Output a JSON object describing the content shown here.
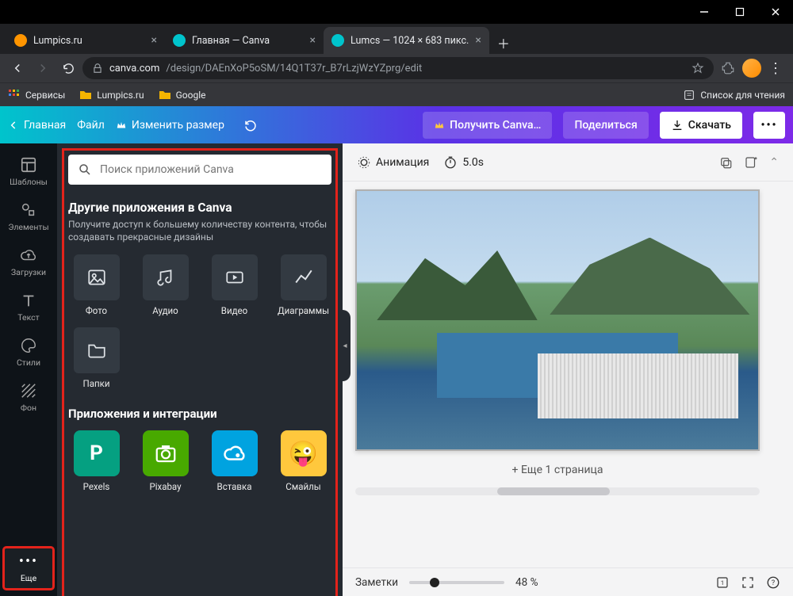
{
  "window_controls": {
    "minimize": "—",
    "maximize": "▢",
    "close": "✕"
  },
  "browser": {
    "tabs": [
      {
        "title": "Lumpics.ru",
        "favicon": "#ff9500",
        "active": false
      },
      {
        "title": "Главная — Canva",
        "favicon": "#00c4cc",
        "active": false
      },
      {
        "title": "Lumcs — 1024 × 683 пикс.",
        "favicon": "#00c4cc",
        "active": true
      }
    ],
    "url_host": "canva.com",
    "url_path": "/design/DAEnXoP5oSM/14Q1T37r_B7rLzjWzYZprg/edit",
    "bookmarks": [
      {
        "label": "Сервисы"
      },
      {
        "label": "Lumpics.ru"
      },
      {
        "label": "Google"
      }
    ],
    "reading_list": "Список для чтения"
  },
  "canva_top": {
    "home": "Главная",
    "file": "Файл",
    "resize": "Изменить размер",
    "get_pro": "Получить Canva…",
    "share": "Поделиться",
    "download": "Скачать"
  },
  "side_rail": [
    {
      "label": "Шаблоны",
      "icon": "templates"
    },
    {
      "label": "Элементы",
      "icon": "elements"
    },
    {
      "label": "Загрузки",
      "icon": "uploads"
    },
    {
      "label": "Текст",
      "icon": "text"
    },
    {
      "label": "Стили",
      "icon": "styles"
    },
    {
      "label": "Фон",
      "icon": "background"
    },
    {
      "label": "Еще",
      "icon": "more",
      "selected": true
    }
  ],
  "apps_panel": {
    "search_placeholder": "Поиск приложений Canva",
    "heading": "Другие приложения в Canva",
    "subheading": "Получите доступ к большему количеству контента, чтобы создавать прекрасные дизайны",
    "tiles": [
      {
        "label": "Фото",
        "icon": "photo"
      },
      {
        "label": "Аудио",
        "icon": "audio"
      },
      {
        "label": "Видео",
        "icon": "video"
      },
      {
        "label": "Диаграммы",
        "icon": "chart"
      },
      {
        "label": "Папки",
        "icon": "folder"
      }
    ],
    "integrations_heading": "Приложения и интеграции",
    "integrations": [
      {
        "label": "Pexels",
        "bg": "#05a081",
        "glyph": "P"
      },
      {
        "label": "Pixabay",
        "bg": "#48a900",
        "glyph": "cam"
      },
      {
        "label": "Вставка",
        "bg": "#00a3e0",
        "glyph": "cloud"
      },
      {
        "label": "Смайлы",
        "bg": "#ffc83d",
        "glyph": "emoji"
      }
    ]
  },
  "canvas": {
    "animation": "Анимация",
    "timing": "5.0s",
    "add_page": "+ Еще 1 страница",
    "notes": "Заметки",
    "zoom": "48 %"
  }
}
